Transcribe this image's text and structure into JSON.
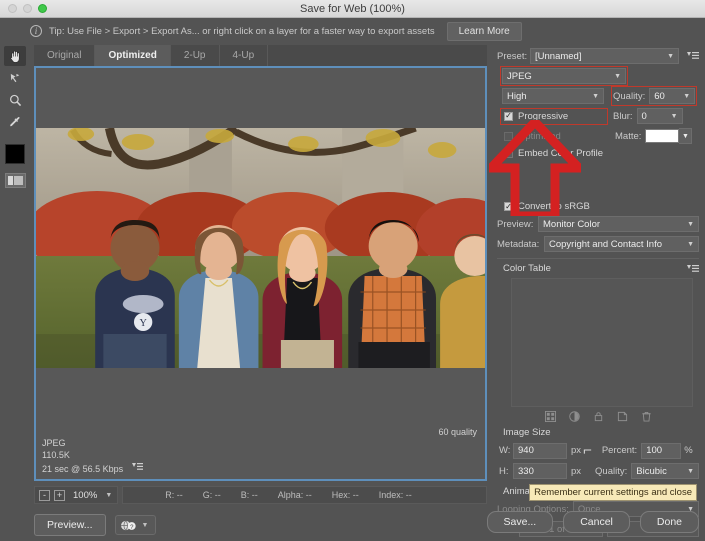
{
  "window": {
    "title": "Save for Web (100%)",
    "traffic_lights": [
      "close",
      "minimize",
      "maximize"
    ]
  },
  "tipbar": {
    "icon": "info-icon",
    "text": "Tip: Use File > Export > Export As... or right click on a layer for a faster way to export assets",
    "button_label": "Learn More"
  },
  "toolbar": {
    "tools": [
      {
        "name": "hand-tool",
        "active": true
      },
      {
        "name": "slice-select-tool",
        "active": false
      },
      {
        "name": "zoom-tool",
        "active": false
      },
      {
        "name": "eyedropper-tool",
        "active": false
      }
    ],
    "foreground_swatch": "#000000",
    "slice_visibility_label": "toggle-slices-visibility"
  },
  "tabs": [
    {
      "label": "Original",
      "active": false
    },
    {
      "label": "Optimized",
      "active": true
    },
    {
      "label": "2-Up",
      "active": false
    },
    {
      "label": "4-Up",
      "active": false
    }
  ],
  "preview": {
    "format": "JPEG",
    "filesize": "110.5K",
    "download_time": "21 sec @ 56.5 Kbps",
    "quality_note": "60 quality",
    "image_alt": "Four students seated outdoors in front of autumn foliage and a tree"
  },
  "statusbar": {
    "zoom_out_label": "-",
    "zoom_in_label": "+",
    "zoom_level": "100%",
    "readouts": [
      "R: --",
      "G: --",
      "B: --",
      "Alpha: --",
      "Hex: --",
      "Index: --"
    ]
  },
  "bottom_left": {
    "preview_button": "Preview...",
    "browser_select_label": "preview-in-browser"
  },
  "actions": {
    "save": "Save...",
    "cancel": "Cancel",
    "done": "Done"
  },
  "tooltip": {
    "text": "Remember current settings and close"
  },
  "settings": {
    "preset_label": "Preset:",
    "preset_value": "[Unnamed]",
    "format_value": "JPEG",
    "format_highlighted": true,
    "compression_value": "High",
    "quality_label": "Quality:",
    "quality_value": "60",
    "quality_highlighted": true,
    "blur_label": "Blur:",
    "blur_value": "0",
    "matte_label": "Matte:",
    "matte_color": "#ffffff",
    "checkboxes": [
      {
        "label": "Progressive",
        "checked": true,
        "disabled": false,
        "highlighted": true
      },
      {
        "label": "Optimized",
        "checked": false,
        "disabled": true,
        "highlighted": false
      },
      {
        "label": "Embed Color Profile",
        "checked": false,
        "disabled": false,
        "highlighted": false
      },
      {
        "label": "Convert to sRGB",
        "checked": true,
        "disabled": false,
        "highlighted": true
      }
    ],
    "preview_label": "Preview:",
    "preview_value": "Monitor Color",
    "metadata_label": "Metadata:",
    "metadata_value": "Copyright and Contact Info",
    "color_table_title": "Color Table",
    "color_table_icons": [
      "snap-to-web-palette-icon",
      "web-shift-icon",
      "lock-color-icon",
      "new-color-icon",
      "delete-color-icon"
    ]
  },
  "image_size": {
    "title": "Image Size",
    "width_label": "W:",
    "width_value": "940",
    "width_unit": "px",
    "height_label": "H:",
    "height_value": "330",
    "height_unit": "px",
    "percent_label": "Percent:",
    "percent_value": "100",
    "percent_unit": "%",
    "quality_label": "Quality:",
    "quality_value": "Bicubic",
    "link_icon": "chain-link-icon"
  },
  "animation": {
    "title": "Animation",
    "looping_label": "Looping Options:",
    "looping_value": "Once",
    "frame_counter": "1 of 1",
    "disabled": true
  },
  "annotation": {
    "type": "red-up-arrow",
    "color": "#d42121",
    "points_to": "Progressive"
  }
}
